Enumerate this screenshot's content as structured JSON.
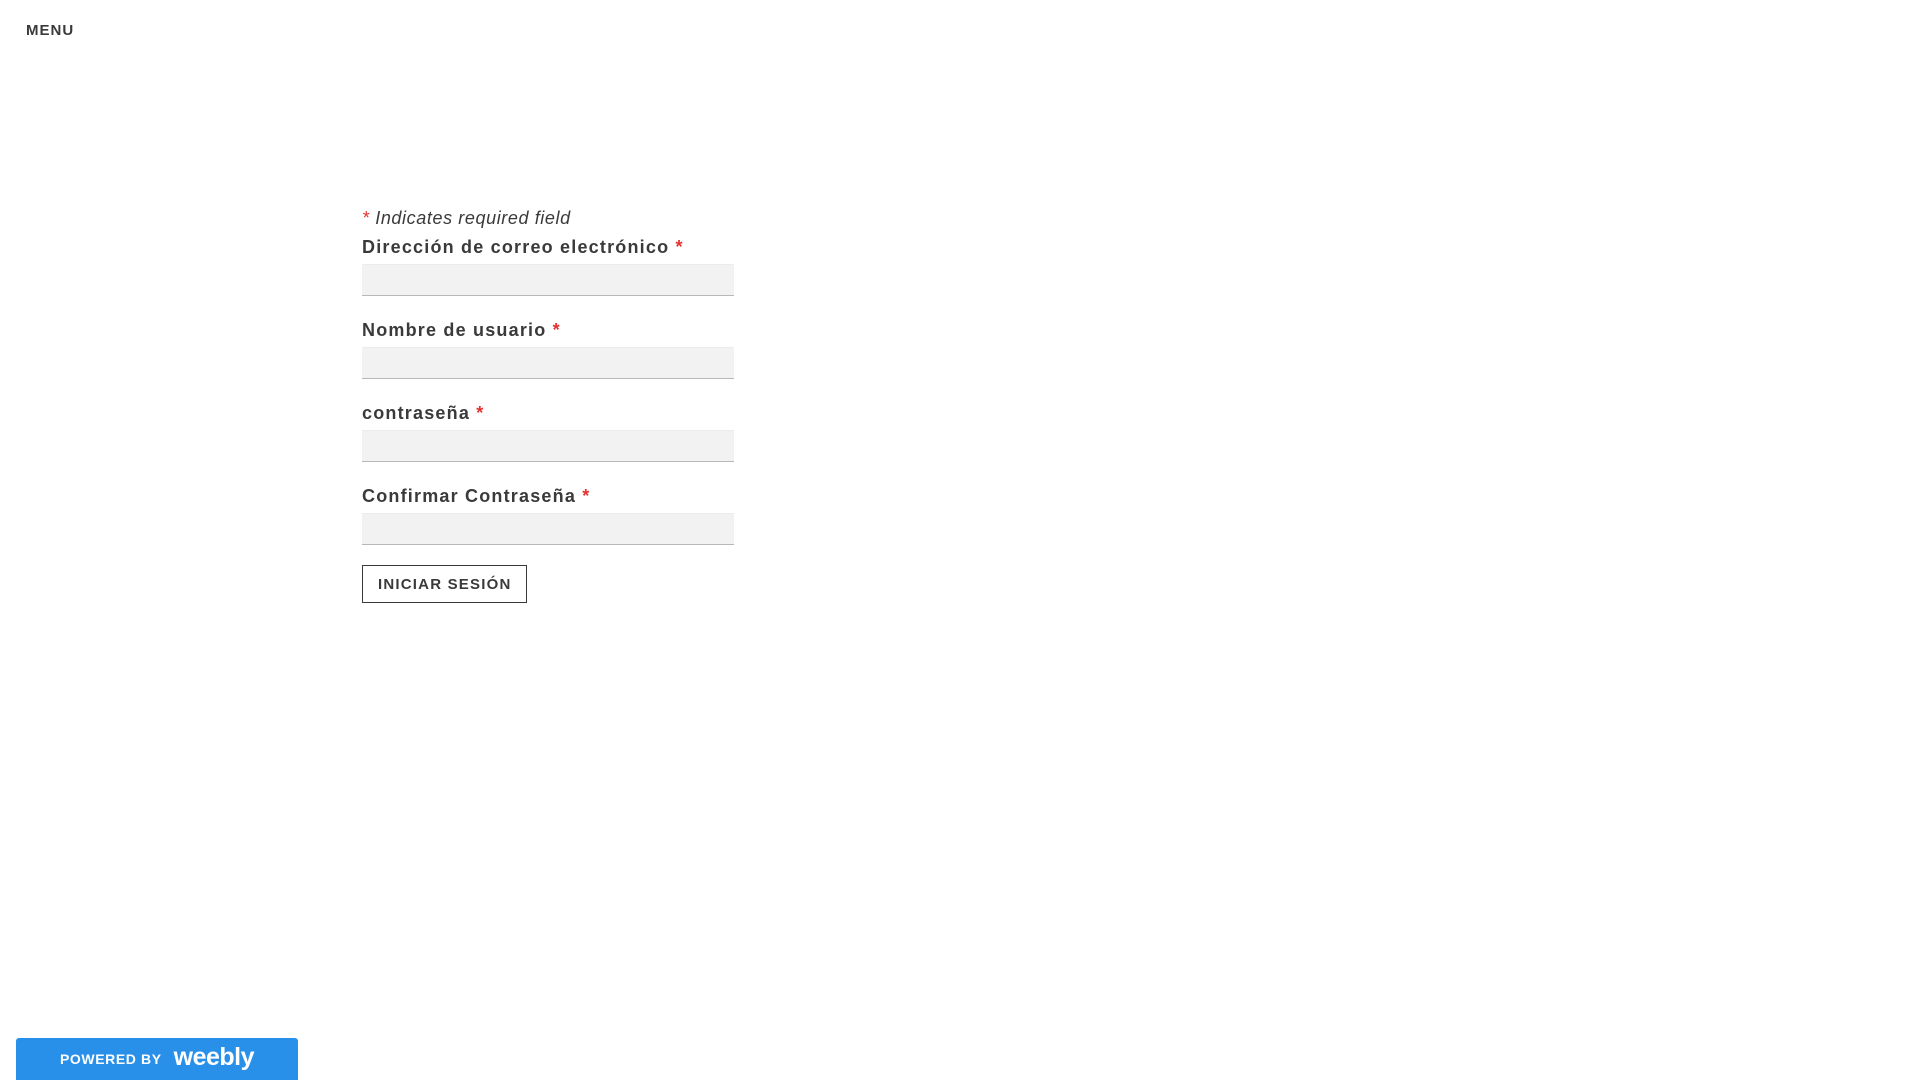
{
  "header": {
    "menu_label": "MENU"
  },
  "form": {
    "required_note_asterisk": "*",
    "required_note": "Indicates required field",
    "fields": [
      {
        "label": "Dirección de correo electrónico",
        "required_mark": "*",
        "value": "",
        "placeholder": ""
      },
      {
        "label": "Nombre de usuario",
        "required_mark": "*",
        "value": "",
        "placeholder": ""
      },
      {
        "label": "contraseña",
        "required_mark": "*",
        "value": "",
        "placeholder": ""
      },
      {
        "label": "Confirmar Contraseña",
        "required_mark": "*",
        "value": "",
        "placeholder": ""
      }
    ],
    "submit_label": "INICIAR SESIÓN"
  },
  "footer": {
    "powered_by": "POWERED BY",
    "brand": "weebly"
  },
  "colors": {
    "required_asterisk": "#e53030",
    "footer_badge": "#2990ea",
    "input_background": "#f2f2f2"
  }
}
